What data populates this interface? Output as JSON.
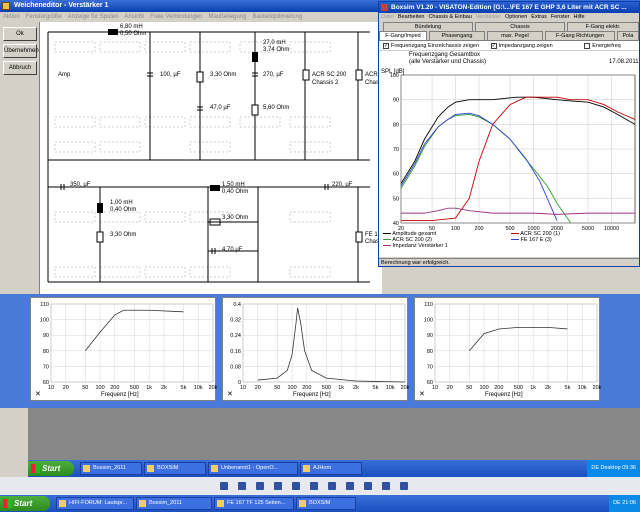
{
  "editor": {
    "title": "Weicheneditor - Verstärker 1",
    "menu": [
      "Aktion",
      "Fenstergröße",
      "Anzeige für Spulen",
      "Ansicht",
      "Freie Verbindungen",
      "Maußeilegung",
      "Bauteiloptimierung"
    ],
    "buttons": {
      "ok": "Ok",
      "uebernehmen": "Übernehmen",
      "abbruch": "Abbruch"
    },
    "labels": {
      "amp": "Amp",
      "l1": "6,80 mH",
      "l1r": "0,50 Ohm",
      "c1": "100, µF",
      "r1": "3,30 Ohm",
      "c2": "47,0 µF",
      "l2": "27,0 mH",
      "l2r": "3,74 Ohm",
      "c3": "270, µF",
      "r2": "5,60 Ohm",
      "acr1": "ACR SC 200",
      "acr1b": "Chassis 2",
      "acr2": "ACR",
      "acr2b": "Chas",
      "c4": "350, µF",
      "l3": "1,00 mH",
      "l3r": "0,40 Ohm",
      "r3": "3,30 Ohm",
      "l4": "1,50 mH",
      "l4r": "0,40 Ohm",
      "r4": "3,30 Ohm",
      "c5": "4,70 µF",
      "c6": "220, µF",
      "fe": "FE 1",
      "fe2": "Chas"
    }
  },
  "boxsim": {
    "title": "Boxsim V1.20 - VISATON-Edition [G:\\...\\FE 167 E GHP 3,6 Liter mit ACR SC ...",
    "menu": [
      "Datei",
      "Bearbeiten",
      "Chassis & Einbau",
      "Verstärker",
      "Optionen",
      "Extras",
      "Fenster",
      "Hilfe"
    ],
    "tabs_row1": [
      "Bündelung",
      "Chassis",
      "F-Gang elektr."
    ],
    "tabs_row2": [
      "F-Gang/Imped",
      "Phasengang",
      "max. Pegel",
      "F-Gang Richtungen",
      "Pola"
    ],
    "checkboxes": [
      {
        "label": "Frequenzgang Einzelchassis zeigen",
        "checked": "✓"
      },
      {
        "label": "Impedanzgang zeigen",
        "checked": "✓"
      },
      {
        "label": "Energiefreq",
        "checked": ""
      }
    ],
    "graph": {
      "title": "Frequenzgang Gesamtbox",
      "subtitle": "(alle Verstärker und Chassis)",
      "date": "17.08.2011",
      "ylabel": "SPL [dB]",
      "yticks": [
        "100",
        "90",
        "80",
        "70",
        "60",
        "50",
        "40"
      ],
      "xticks": [
        "20",
        "50",
        "100",
        "200",
        "500",
        "1000",
        "2000",
        "5000",
        "10000"
      ],
      "legend": [
        "Amplitude gesamt",
        "ACR SC 200 (1)",
        "ACR SC 200 (2)",
        "FE 167 E (3)",
        "Impedanz Verstärker 1"
      ],
      "colors": {
        "total": "#000000",
        "acr1": "#c00000",
        "acr2": "#30a030",
        "fe": "#3040d0",
        "imp": "#a03080"
      }
    },
    "status": "Berechnung war erfolgreich."
  },
  "minigraphs": [
    {
      "yticks": [
        "110",
        "100",
        "90",
        "80",
        "70",
        "60"
      ],
      "xticks": [
        "10",
        "20",
        "50",
        "100",
        "200",
        "500",
        "1k",
        "2k",
        "5k",
        "10k",
        "20k"
      ],
      "xlabel": "Frequenz [Hz]"
    },
    {
      "yticks": [
        "0.4",
        "0.32",
        "0.24",
        "0.16",
        "0.08",
        "0"
      ],
      "xticks": [
        "10",
        "20",
        "50",
        "100",
        "200",
        "500",
        "1k",
        "2k",
        "5k",
        "10k",
        "20k"
      ],
      "xlabel": "Frequenz [Hz]"
    },
    {
      "yticks": [
        "110",
        "100",
        "90",
        "80",
        "70",
        "60"
      ],
      "xticks": [
        "10",
        "20",
        "50",
        "100",
        "200",
        "500",
        "1k",
        "2k",
        "5k",
        "10k",
        "20k"
      ],
      "xlabel": "Frequenz [Hz]"
    }
  ],
  "taskbar1": {
    "start": "Start",
    "items": [
      "Boxsim_2011",
      "BOXSIM",
      "Unbenannt1 - OpenO...",
      "AJHorn"
    ],
    "tray": "DE   Desktop   09:36"
  },
  "taskbar2": {
    "start": "Start",
    "items": [
      "HIFI-FORUM: Lautspr...",
      "Boxsim_2011",
      "FE 167 TF 125 Seiten...",
      "BOXSIM"
    ],
    "tray": "DE   21:06"
  }
}
